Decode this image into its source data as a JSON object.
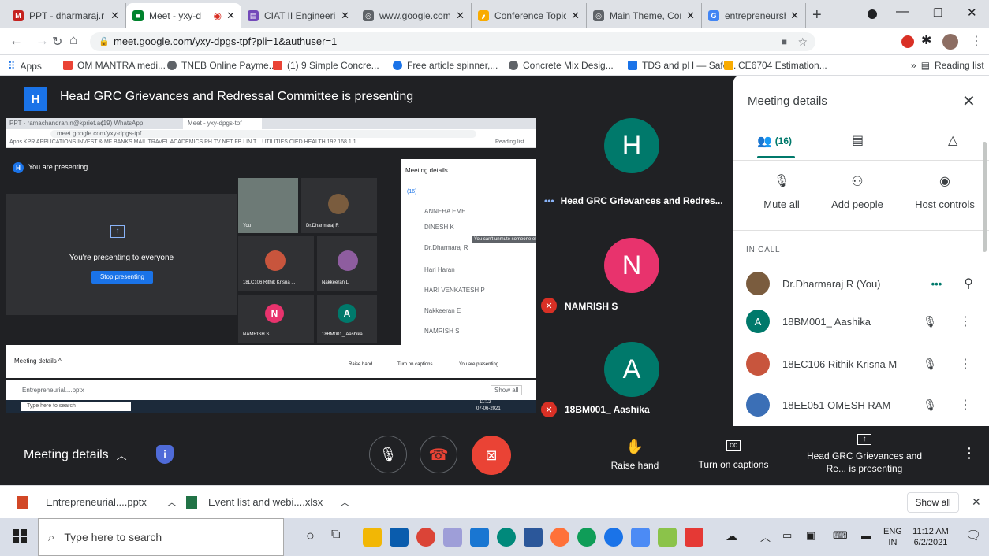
{
  "browser": {
    "tabs": [
      {
        "title": "PPT - dharmaraj.r",
        "color": "#c5221f",
        "glyph": "M"
      },
      {
        "title": "Meet - yxy-d",
        "color": "#00832d",
        "glyph": "■"
      },
      {
        "title": "CIAT II Engineerin",
        "color": "#7248b9",
        "glyph": "▤"
      },
      {
        "title": "www.google.com",
        "color": "#5f6368",
        "glyph": "◎"
      },
      {
        "title": "Conference Topic",
        "color": "#f9ab00",
        "glyph": "⸙"
      },
      {
        "title": "Main Theme, Con",
        "color": "#5f6368",
        "glyph": "◎"
      },
      {
        "title": "entrepreneurship",
        "color": "#4285f4",
        "glyph": "G"
      }
    ],
    "url": "meet.google.com/yxy-dpgs-tpf?pli=1&authuser=1",
    "bookmarks": [
      "Apps",
      "OM MANTRA medi...",
      "TNEB Online Payme...",
      "(1) 9 Simple Concre...",
      "Free article spinner,...",
      "Concrete Mix Desig...",
      "TDS and pH — Safe...",
      "CE6704 Estimation..."
    ],
    "bookmark_colors": [
      "#ea4335",
      "#ea4335",
      "#5f6368",
      "#ea4335",
      "#1a73e8",
      "#5f6368",
      "#1a73e8",
      "#f9ab00"
    ],
    "reading_list": "Reading list",
    "overflow": "»"
  },
  "presenter": {
    "initial": "H",
    "banner": "Head GRC Grievances and Redressal Committee is presenting"
  },
  "inner": {
    "tab1": "PPT - ramachandran.n@kpriet.ac",
    "tab2": "(19) WhatsApp",
    "tab3": "Meet - yxy-dpgs-tpf",
    "url": "meet.google.com/yxy-dpgs-tpf",
    "bookmarks": "Apps  KPR APPLICATIONS  INVEST & MF  BANKS  MAIL  TRAVEL  ACADEMICS  PH TV NET FB LIN T...  UTILITIES  CIED  HEALTH  192.168.1.1",
    "reading": "Reading list",
    "you_presenting": "You are presenting",
    "presenting_everyone": "You're presenting to everyone",
    "stop": "Stop presenting",
    "tiles": [
      "You",
      "Dr.Dharmaraj R",
      "18LC106 Rithik Krisna ...",
      "Nakkeeran L",
      "NAMRISH S",
      "18BM001_ Aashika"
    ],
    "panel_title": "Meeting details",
    "count": "(16)",
    "list": [
      "ANNEHA EME",
      "DINESH K",
      "Dr.Dharmaraj R",
      "Hari Haran",
      "HARI VENKATESH P",
      "Nakkeeran E",
      "NAMRISH S"
    ],
    "tooltip": "You can't unmute someone else",
    "meeting_details": "Meeting details  ^",
    "raise": "Raise hand",
    "captions": "Turn on captions",
    "presenting": "You are presenting",
    "download": "Entrepreneurial....pptx",
    "show_all": "Show all",
    "search": "Type here to search",
    "time": "11:12",
    "date": "07-06-2021"
  },
  "tiles": [
    {
      "initial": "H",
      "color": "#00796b",
      "name": "Head GRC Grievances and Redres...",
      "muted": false
    },
    {
      "initial": "N",
      "color": "#e8336d",
      "name": "NAMRISH S",
      "muted": true
    },
    {
      "initial": "A",
      "color": "#00796b",
      "name": "18BM001_ Aashika",
      "muted": true
    }
  ],
  "panel": {
    "title": "Meeting details",
    "count": "(16)",
    "mute_all": "Mute all",
    "add_people": "Add people",
    "host_controls": "Host controls",
    "in_call": "IN CALL",
    "people": [
      {
        "name": "Dr.Dharmaraj R (You)",
        "avatar_color": "#7a5c3e",
        "initial": ""
      },
      {
        "name": "18BM001_ Aashika",
        "avatar_color": "#00796b",
        "initial": "A"
      },
      {
        "name": "18EC106 Rithik Krisna M",
        "avatar_color": "#c8553d",
        "initial": ""
      },
      {
        "name": "18EE051 OMESH RAM",
        "avatar_color": "#3b6fb6",
        "initial": ""
      }
    ]
  },
  "controls": {
    "meeting_details": "Meeting details",
    "raise_hand": "Raise hand",
    "captions": "Turn on captions",
    "presenting": "Head GRC Grievances and Re... is presenting"
  },
  "downloads": {
    "file1": "Entrepreneurial....pptx",
    "file2": "Event list and webi....xlsx",
    "show_all": "Show all"
  },
  "taskbar": {
    "search": "Type here to search",
    "lang1": "ENG",
    "lang2": "IN",
    "time": "11:12 AM",
    "date": "6/2/2021"
  },
  "colors": {
    "accent": "#1a73e8",
    "teal": "#00796b",
    "red": "#d93025",
    "dark": "#202124"
  }
}
